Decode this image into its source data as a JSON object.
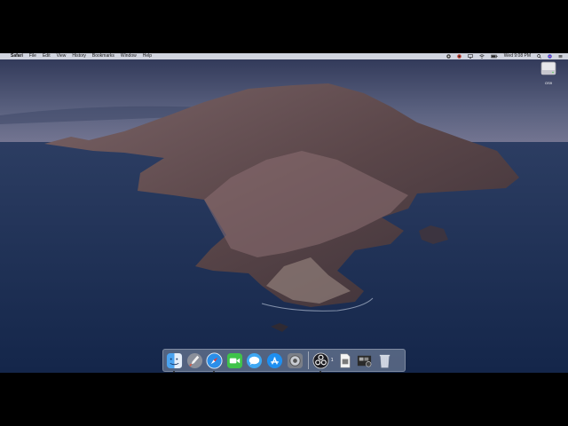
{
  "menubar": {
    "app": "Safari",
    "items": [
      "File",
      "Edit",
      "View",
      "History",
      "Bookmarks",
      "Window",
      "Help"
    ],
    "clock": "Wed 9:08 PM"
  },
  "desktop": {
    "drive_label": "OS9"
  },
  "dock": {
    "apps": [
      "Finder",
      "Launchpad",
      "Safari",
      "FaceTime",
      "Messages",
      "App Store",
      "System Preferences",
      "OBS"
    ],
    "obs_badge": "1",
    "others": [
      "Document",
      "Photo Booth",
      "Trash"
    ]
  },
  "colors": {
    "sky": "#3a4466",
    "sea": "#1f3358",
    "island": "#5b4a4d",
    "menubar": "#dee2ea"
  }
}
